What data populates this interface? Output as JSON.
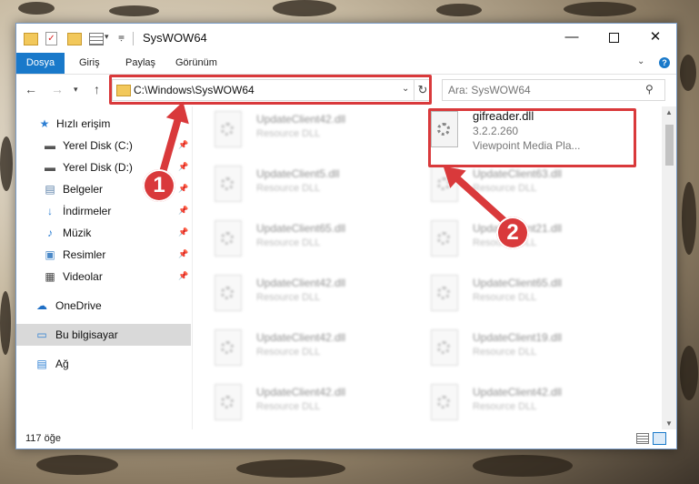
{
  "window": {
    "title": "SysWOW64",
    "minimize": "—",
    "close": "✕"
  },
  "ribbon": {
    "tabs": [
      "Dosya",
      "Giriş",
      "Paylaş",
      "Görünüm"
    ],
    "help": "?"
  },
  "address": {
    "path": "C:\\Windows\\SysWOW64"
  },
  "search": {
    "placeholder": "Ara: SysWOW64"
  },
  "sidebar": {
    "items": [
      {
        "label": "Hızlı erişim",
        "icon": "star-icon"
      },
      {
        "label": "Yerel Disk (C:)",
        "icon": "drive-icon",
        "pinned": true
      },
      {
        "label": "Yerel Disk (D:)",
        "icon": "drive-icon",
        "pinned": true
      },
      {
        "label": "Belgeler",
        "icon": "documents-icon",
        "pinned": true
      },
      {
        "label": "İndirmeler",
        "icon": "downloads-icon",
        "pinned": true
      },
      {
        "label": "Müzik",
        "icon": "music-icon",
        "pinned": true
      },
      {
        "label": "Resimler",
        "icon": "pictures-icon",
        "pinned": true
      },
      {
        "label": "Videolar",
        "icon": "videos-icon",
        "pinned": true
      },
      {
        "label": "OneDrive",
        "icon": "onedrive-icon"
      },
      {
        "label": "Bu bilgisayar",
        "icon": "computer-icon",
        "selected": true
      },
      {
        "label": "Ağ",
        "icon": "network-icon"
      }
    ]
  },
  "files": {
    "left": [
      {
        "name": "UpdateClient42.dll",
        "type": "Resource DLL"
      },
      {
        "name": "UpdateClient5.dll",
        "type": "Resource DLL"
      },
      {
        "name": "UpdateClient65.dll",
        "type": "Resource DLL"
      },
      {
        "name": "UpdateClient42.dll",
        "type": "Resource DLL"
      },
      {
        "name": "UpdateClient42.dll",
        "type": "Resource DLL"
      },
      {
        "name": "UpdateClient42.dll",
        "type": "Resource DLL"
      }
    ],
    "highlighted": {
      "name": "gifreader.dll",
      "version": "3.2.2.260",
      "company": "Viewpoint Media Pla..."
    },
    "right": [
      {
        "name": "UpdateClient63.dll",
        "type": "Resource DLL"
      },
      {
        "name": "UpdateClient21.dll",
        "type": "Resource DLL"
      },
      {
        "name": "UpdateClient65.dll",
        "type": "Resource DLL"
      },
      {
        "name": "UpdateClient19.dll",
        "type": "Resource DLL"
      },
      {
        "name": "UpdateClient42.dll",
        "type": "Resource DLL"
      }
    ]
  },
  "status": {
    "count": "117 öğe"
  },
  "annotations": {
    "step1": "1",
    "step2": "2",
    "color": "#d9393b"
  }
}
